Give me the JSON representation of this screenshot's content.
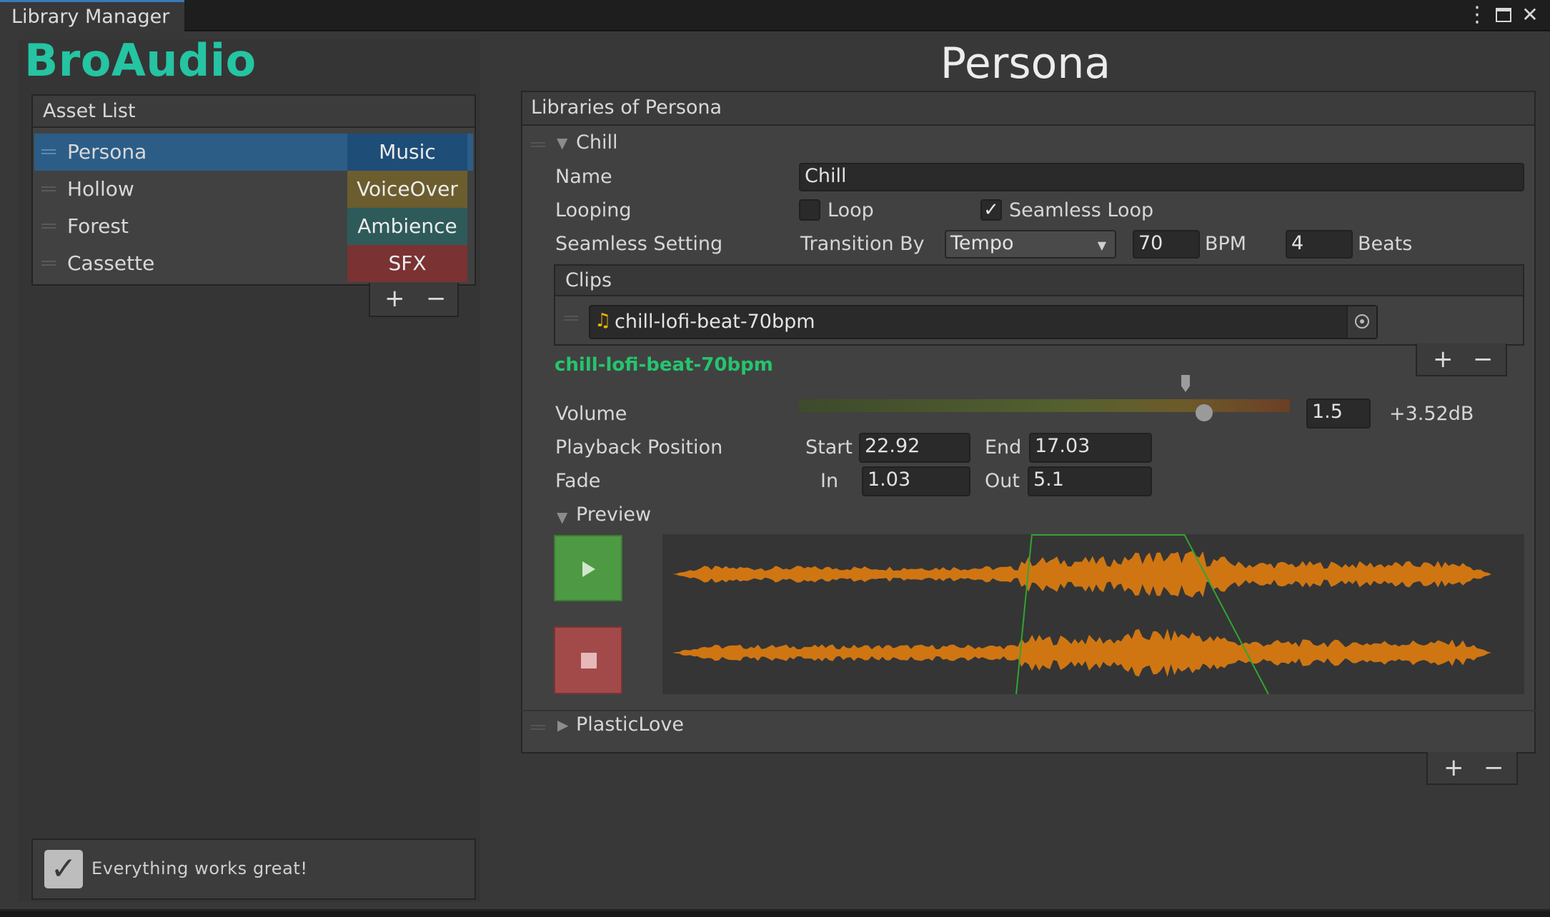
{
  "window": {
    "tab_title": "Library Manager",
    "menu_icon": "vertical-ellipsis-icon",
    "maximize_icon": "maximize-icon",
    "close_icon": "close-icon"
  },
  "brand": {
    "logo_text": "BroAudio",
    "color": "#25c4a3"
  },
  "asset_list": {
    "header": "Asset List",
    "items": [
      {
        "name": "Persona",
        "type": "Music",
        "type_color": "#1e4d78",
        "selected": true
      },
      {
        "name": "Hollow",
        "type": "VoiceOver",
        "type_color": "#6b5d2e",
        "selected": false
      },
      {
        "name": "Forest",
        "type": "Ambience",
        "type_color": "#2e5a5a",
        "selected": false
      },
      {
        "name": "Cassette",
        "type": "SFX",
        "type_color": "#7a3232",
        "selected": false
      }
    ],
    "add_label": "+",
    "remove_label": "−"
  },
  "status": {
    "checked": true,
    "text": "Everything works great!"
  },
  "main": {
    "title": "Persona",
    "libraries_header": "Libraries of Persona",
    "library": {
      "name_header": "Chill",
      "name_label": "Name",
      "name_value": "Chill",
      "looping_label": "Looping",
      "loop_label": "Loop",
      "loop_checked": false,
      "seamless_loop_label": "Seamless Loop",
      "seamless_loop_checked": true,
      "seamless_setting_label": "Seamless Setting",
      "transition_by_label": "Transition By",
      "transition_by_value": "Tempo",
      "bpm_value": "70",
      "bpm_unit": "BPM",
      "beats_value": "4",
      "beats_unit": "Beats",
      "clips_header": "Clips",
      "clip_file": "chill-lofi-beat-70bpm",
      "clip_icon": "audio-clip-note-icon",
      "clip_picker_icon": "object-picker-icon",
      "selected_clip_label": "chill-lofi-beat-70bpm",
      "selected_clip_color": "#25c46e",
      "volume_label": "Volume",
      "volume_value": "1.5",
      "volume_db": "+3.52dB",
      "volume_level": 0.82,
      "playback_position_label": "Playback Position",
      "start_label": "Start",
      "start_value": "22.92",
      "end_label": "End",
      "end_value": "17.03",
      "fade_label": "Fade",
      "fade_in_label": "In",
      "fade_in_value": "1.03",
      "fade_out_label": "Out",
      "fade_out_value": "5.1",
      "preview_label": "Preview",
      "play_icon": "play-icon",
      "stop_icon": "stop-icon",
      "waveform_color": "#e07d10",
      "marker_color": "#2fa62f"
    },
    "collapsed_library": "PlasticLove"
  }
}
